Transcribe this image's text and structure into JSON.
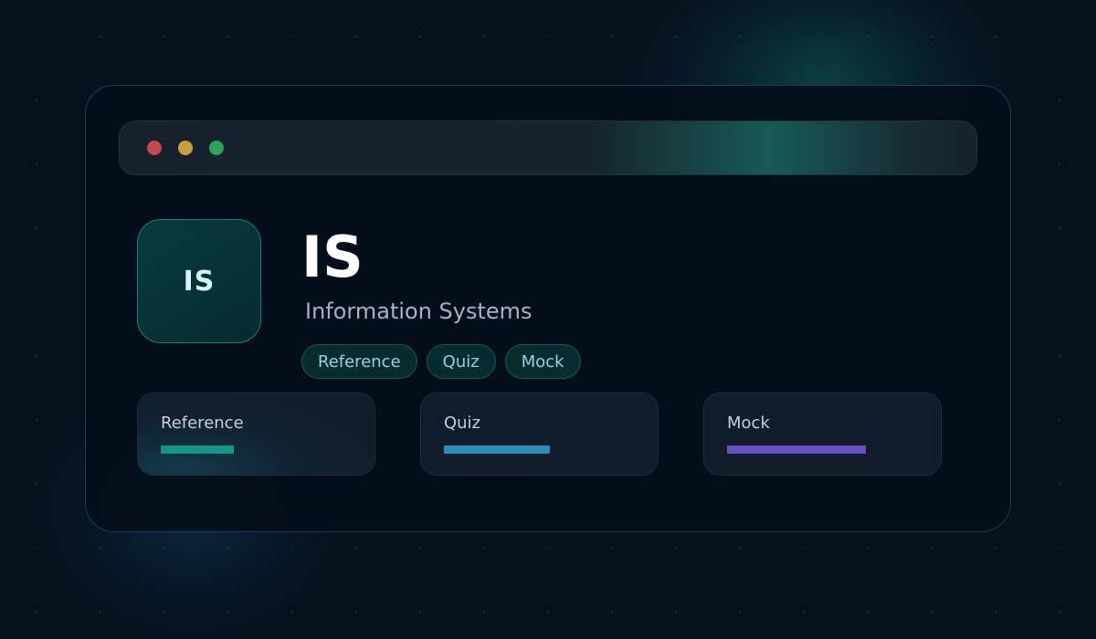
{
  "window": {
    "controls": [
      {
        "name": "close",
        "color": "#c8474d"
      },
      {
        "name": "minimize",
        "color": "#c9a040"
      },
      {
        "name": "maximize",
        "color": "#2ea35a"
      }
    ]
  },
  "header": {
    "logo_text": "IS",
    "title": "IS",
    "subtitle": "Information Systems"
  },
  "tags": [
    "Reference",
    "Quiz",
    "Mock"
  ],
  "cards": [
    {
      "label": "Reference",
      "progress": 0.38,
      "color": "#14968a"
    },
    {
      "label": "Quiz",
      "progress": 0.55,
      "color": "#2a8fb6"
    },
    {
      "label": "Mock",
      "progress": 0.72,
      "color": "#6a4fc2"
    }
  ],
  "colors": {
    "background": "#06111e",
    "accent": "#178076"
  }
}
